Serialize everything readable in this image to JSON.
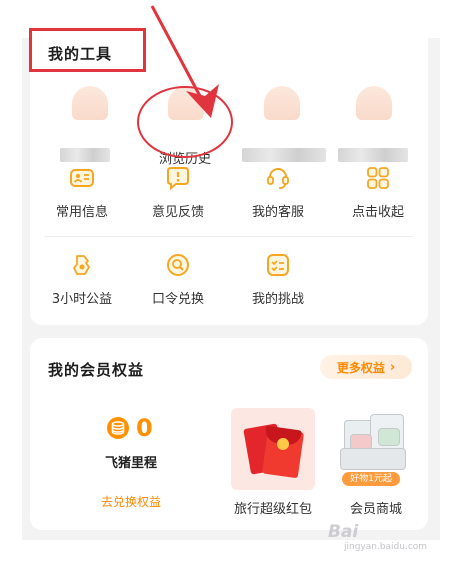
{
  "tools_section": {
    "title": "我的工具",
    "history": [
      {
        "label": ""
      },
      {
        "label": "浏览历史"
      },
      {
        "label": ""
      },
      {
        "label": ""
      }
    ],
    "items": [
      {
        "label": "常用信息",
        "icon": "id-card-icon"
      },
      {
        "label": "意见反馈",
        "icon": "feedback-icon"
      },
      {
        "label": "我的客服",
        "icon": "headset-icon"
      },
      {
        "label": "点击收起",
        "icon": "collapse-grid-icon"
      },
      {
        "label": "3小时公益",
        "icon": "charity-icon"
      },
      {
        "label": "口令兑换",
        "icon": "search-code-icon"
      },
      {
        "label": "我的挑战",
        "icon": "checklist-icon"
      }
    ]
  },
  "vip_section": {
    "title": "我的会员权益",
    "more_label": "更多权益",
    "mileage": {
      "value": "0",
      "label": "飞猪里程",
      "link": "去兑换权益"
    },
    "redpack_label": "旅行超级红包",
    "mall": {
      "badge": "好物1元起",
      "label": "会员商城"
    }
  },
  "watermark": {
    "text": "Bai",
    "sub": "jingyan.baidu.com"
  },
  "colors": {
    "accent": "#ff8a00",
    "annotation": "#e0343e",
    "icon": "#f5a623"
  }
}
